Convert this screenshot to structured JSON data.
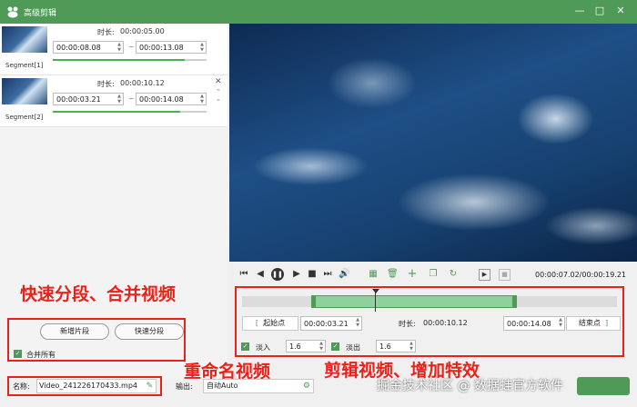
{
  "window": {
    "title": "高级剪辑"
  },
  "segments": [
    {
      "label": "Segment[1]",
      "duration_label": "时长:",
      "duration": "00:00:05.00",
      "start": "00:00:08.08",
      "end": "00:00:13.08"
    },
    {
      "label": "Segment[2]",
      "duration_label": "时长:",
      "duration": "00:00:10.12",
      "start": "00:00:03.21",
      "end": "00:00:14.08"
    }
  ],
  "left_actions": {
    "add_segment": "新增片段",
    "quick_split": "快速分段",
    "merge_all": "合并所有"
  },
  "name_field": {
    "label": "名称:",
    "value": "Video_241226170433.mp4"
  },
  "output_field": {
    "label": "输出:",
    "value": "自动Auto"
  },
  "player": {
    "time": "00:00:07.02/00:00:19.21"
  },
  "clip": {
    "start_button": "起始点",
    "start_value": "00:00:03.21",
    "duration_label": "时长:",
    "duration_value": "00:00:10.12",
    "end_value": "00:00:14.08",
    "end_button": "结束点",
    "fade_in_label": "淡入",
    "fade_in_value": "1.6",
    "fade_out_label": "淡出",
    "fade_out_value": "1.6"
  },
  "annotations": {
    "split_merge": "快速分段、合并视频",
    "rename": "重命名视频",
    "edit": "剪辑视频、增加特效"
  },
  "watermark": "掘金技术社区 @ 数据蛙官方软件",
  "colors": {
    "brand_green": "#4e9a56",
    "annotation_red": "#e8221a"
  }
}
